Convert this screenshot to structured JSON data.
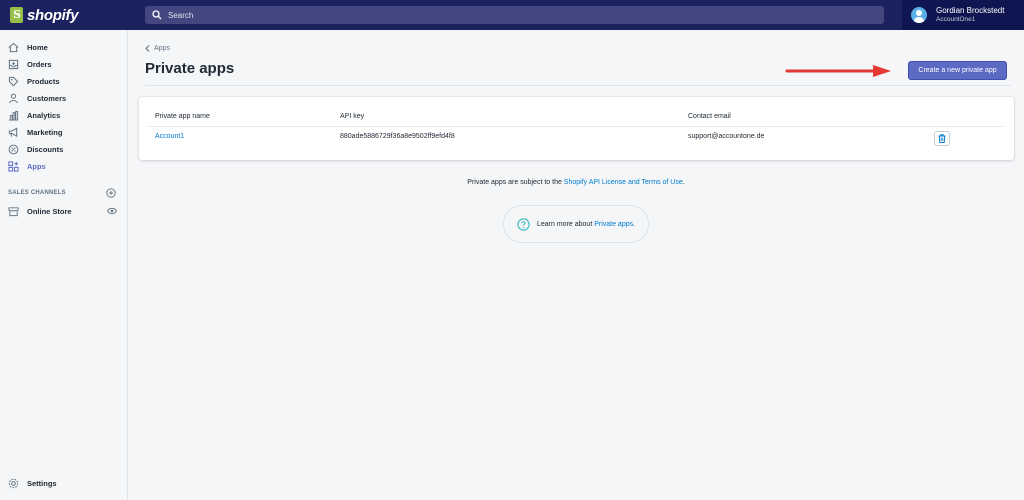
{
  "brand": {
    "logo_text": "shopify"
  },
  "topbar": {
    "search_placeholder": "Search",
    "user_name": "Gordian Brockstedt",
    "user_shop": "AccountOne1"
  },
  "sidebar": {
    "items": [
      {
        "label": "Home",
        "icon": "home-icon"
      },
      {
        "label": "Orders",
        "icon": "orders-icon"
      },
      {
        "label": "Products",
        "icon": "tag-icon"
      },
      {
        "label": "Customers",
        "icon": "person-icon"
      },
      {
        "label": "Analytics",
        "icon": "bar-chart-icon"
      },
      {
        "label": "Marketing",
        "icon": "megaphone-icon"
      },
      {
        "label": "Discounts",
        "icon": "discount-icon"
      },
      {
        "label": "Apps",
        "icon": "apps-icon",
        "active": true
      }
    ],
    "sales_channels_title": "SALES CHANNELS",
    "online_store_label": "Online Store",
    "settings_label": "Settings"
  },
  "page": {
    "breadcrumb": "Apps",
    "title": "Private apps",
    "primary_action": "Create a new private app"
  },
  "table": {
    "headers": [
      "Private app name",
      "API key",
      "Contact email"
    ],
    "rows": [
      {
        "name": "Account1",
        "api_key": "880ade5886729f36a8e9502ff9efd4f8",
        "email": "support@accountone.de"
      }
    ]
  },
  "footer": {
    "note_prefix": "Private apps are subject to the ",
    "note_link": "Shopify API License and Terms of Use",
    "note_suffix": ".",
    "help_prefix": "Learn more about ",
    "help_link": "Private apps",
    "help_suffix": "."
  },
  "colors": {
    "topbar": "#1c2260",
    "primary": "#5c6ac4",
    "link": "#007ace",
    "arrow": "#e53935",
    "help_icon": "#47c1bf"
  }
}
